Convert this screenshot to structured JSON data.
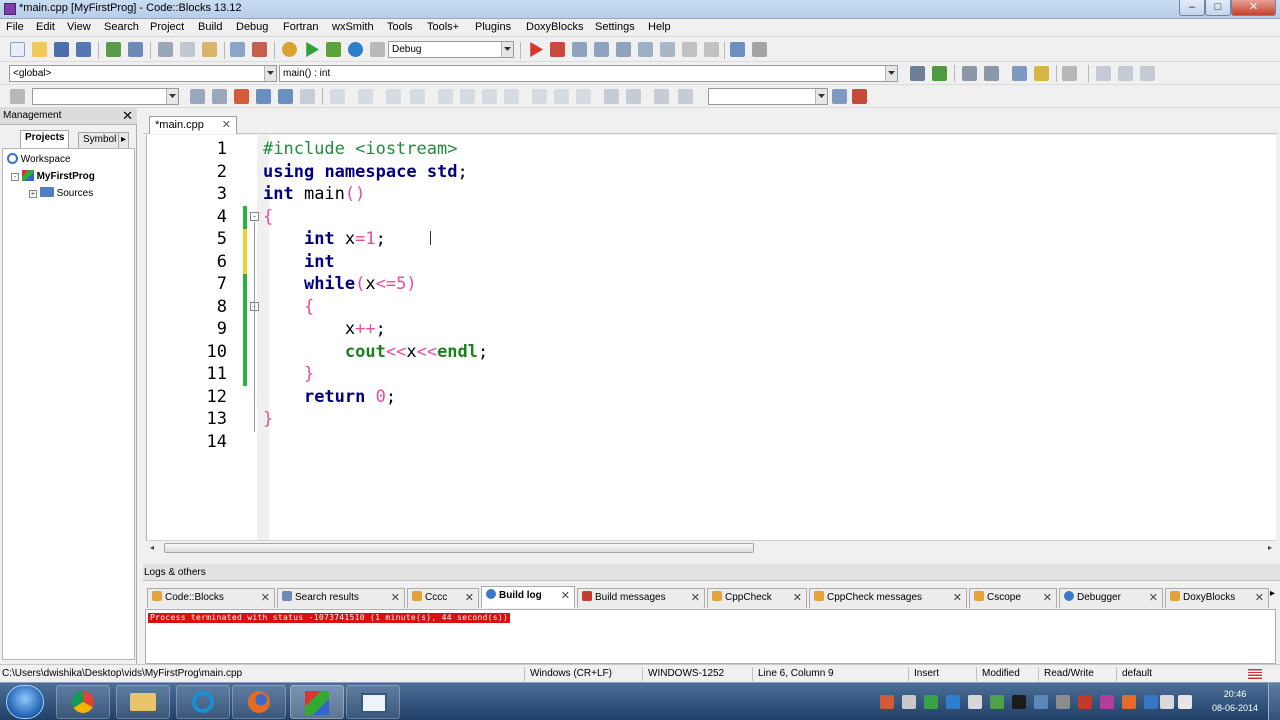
{
  "window": {
    "title": "*main.cpp [MyFirstProg] - Code::Blocks 13.12",
    "minimize": "–",
    "maximize": "□",
    "close": "✕"
  },
  "menu": [
    "File",
    "Edit",
    "View",
    "Search",
    "Project",
    "Build",
    "Debug",
    "Fortran",
    "wxSmith",
    "Tools",
    "Tools+",
    "Plugins",
    "DoxyBlocks",
    "Settings",
    "Help"
  ],
  "toolbar": {
    "build_target": "Debug",
    "scope": "<global>",
    "function": "main() : int"
  },
  "management": {
    "title": "Management",
    "close": "✕",
    "tabs": [
      "Projects",
      "Symbol"
    ],
    "tab_next": "▸",
    "tree": {
      "workspace": "Workspace",
      "project": "MyFirstProg",
      "sources": "Sources"
    }
  },
  "editor": {
    "tab": "*main.cpp",
    "tab_close": "✕",
    "line_numbers": [
      "1",
      "2",
      "3",
      "4",
      "5",
      "6",
      "7",
      "8",
      "9",
      "10",
      "11",
      "12",
      "13",
      "14"
    ],
    "code": {
      "l1_pre": "#include <iostream>",
      "l2_kw1": "using",
      "l2_kw2": "namespace",
      "l2_kw3": "std",
      "l2_rest": ";",
      "l3_kw": "int",
      "l3_rest": " main",
      "l3_paren": "()",
      "l4_brace": "{",
      "l5_kw": "int",
      "l5_var": " x",
      "l5_op": "=",
      "l5_num": "1",
      "l5_end": ";",
      "l6_kw": "int",
      "l7_kw": "while",
      "l7_p1": "(",
      "l7_var": "x",
      "l7_op": "<=",
      "l7_num": "5",
      "l7_p2": ")",
      "l8_brace": "{",
      "l9_var": "x",
      "l9_op": "++",
      "l9_end": ";",
      "l10_fn": "cout",
      "l10_op1": "<<",
      "l10_var": "x",
      "l10_op2": "<<",
      "l10_fn2": "endl",
      "l10_end": ";",
      "l11_brace": "}",
      "l12_kw": "return",
      "l12_num": "0",
      "l12_end": ";",
      "l13_brace": "}"
    }
  },
  "logs": {
    "title": "Logs & others",
    "tabs": [
      "Code::Blocks",
      "Search results",
      "Cccc",
      "Build log",
      "Build messages",
      "CppCheck",
      "CppCheck messages",
      "Cscope",
      "Debugger",
      "DoxyBlocks"
    ],
    "active_tab": "Build log",
    "tab_close": "✕",
    "message": "Process terminated with status -1073741510 (1 minute(s), 44 second(s))"
  },
  "status": {
    "path": "C:\\Users\\dwishika\\Desktop\\vids\\MyFirstProg\\main.cpp",
    "eol": "Windows (CR+LF)",
    "encoding": "WINDOWS-1252",
    "position": "Line 6, Column 9",
    "mode": "Insert",
    "modified": "Modified",
    "access": "Read/Write",
    "profile": "default"
  },
  "taskbar": {
    "time": "20:46",
    "date": "08-06-2014"
  },
  "colors": {
    "keyword": "#00007f",
    "preprocessor": "#1e8c3a",
    "number": "#e84d9c",
    "changed_saved": "#28b33c",
    "changed_unsaved": "#f0d02c",
    "error_bg": "#d81010"
  }
}
